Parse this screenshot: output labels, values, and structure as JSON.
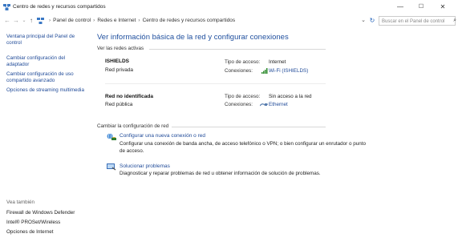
{
  "window": {
    "title": "Centro de redes y recursos compartidos",
    "minimize": "—",
    "maximize": "☐",
    "close": "✕"
  },
  "nav": {
    "back": "←",
    "forward": "→",
    "dropdown": "⌄",
    "up": "↑"
  },
  "breadcrumb": {
    "items": [
      "Panel de control",
      "Redes e Internet",
      "Centro de redes y recursos compartidos"
    ],
    "separator": "›"
  },
  "address": {
    "dropdown": "⌄",
    "refresh": "↻"
  },
  "search": {
    "placeholder": "Buscar en el Panel de control",
    "icon": "⌕"
  },
  "sidebar": {
    "items": [
      "Ventana principal del Panel de control",
      "Cambiar configuración del adaptador",
      "Cambiar configuración de uso compartido avanzado",
      "Opciones de streaming multimedia"
    ],
    "see_also_title": "Vea también",
    "see_also": [
      "Firewall de Windows Defender",
      "Intel® PROSet/Wireless",
      "Opciones de Internet"
    ]
  },
  "main": {
    "title": "Ver información básica de la red y configurar conexiones",
    "active_networks_header": "Ver las redes activas",
    "networks": [
      {
        "name": "ISHIELDS",
        "category": "Red privada",
        "access_label": "Tipo de acceso:",
        "access_value": "Internet",
        "connections_label": "Conexiones:",
        "connection": "Wi-Fi (ISHIELDS)",
        "icon": "wifi-signal-icon"
      },
      {
        "name": "Red no identificada",
        "category": "Red pública",
        "access_label": "Tipo de acceso:",
        "access_value": "Sin acceso a la red",
        "connections_label": "Conexiones:",
        "connection": "Ethernet",
        "icon": "ethernet-icon"
      }
    ],
    "change_settings_header": "Cambiar la configuración de red",
    "tasks": [
      {
        "link": "Configurar una nueva conexión o red",
        "desc": "Configurar una conexión de banda ancha, de acceso telefónico o VPN; o bien configurar un enrutador o punto de acceso.",
        "icon": "new-connection-icon"
      },
      {
        "link": "Solucionar problemas",
        "desc": "Diagnosticar y reparar problemas de red u obtener información de solución de problemas.",
        "icon": "troubleshoot-icon"
      }
    ]
  },
  "colors": {
    "link": "#1f4a98",
    "title": "#1f4f9e",
    "wifi": "#2e8b2e"
  }
}
